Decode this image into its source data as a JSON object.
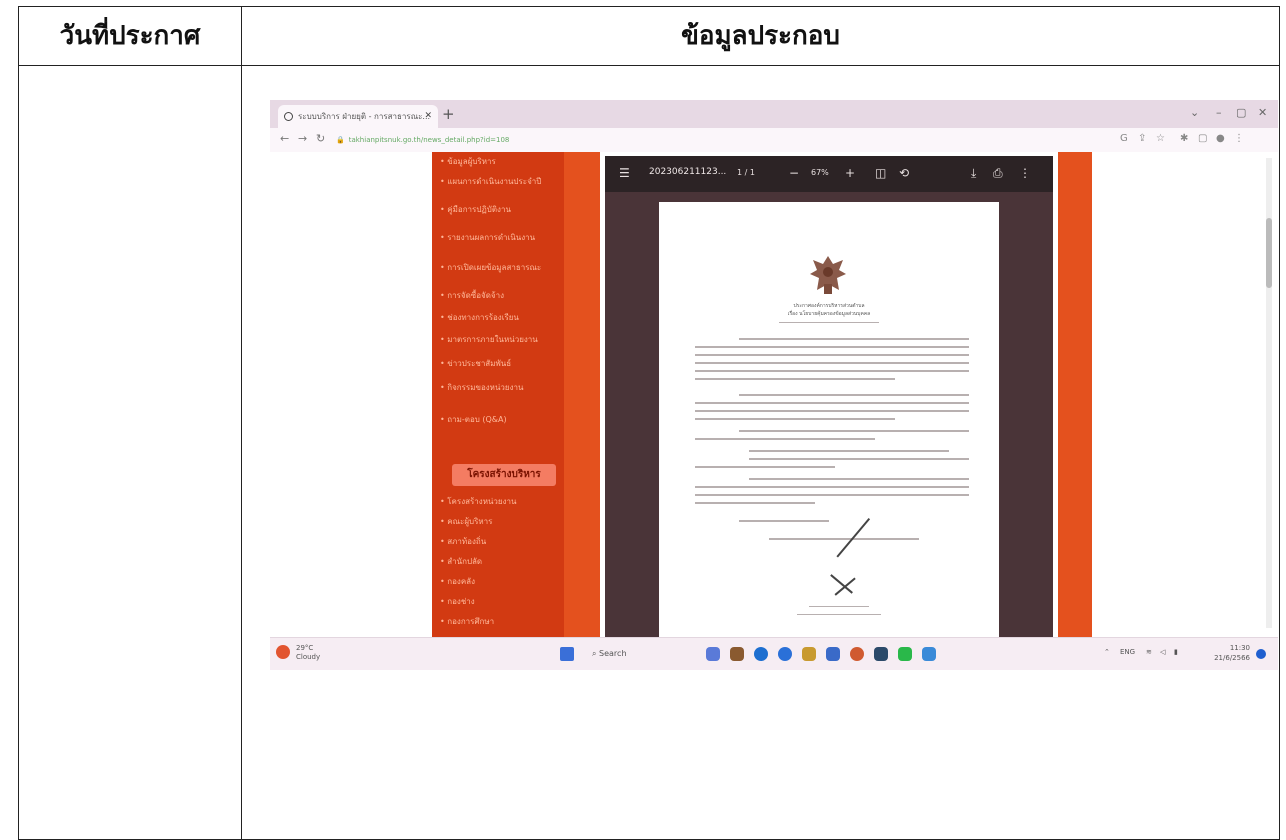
{
  "table": {
    "header_date": "วันที่ประกาศ",
    "header_info": "ข้อมูลประกอบ"
  },
  "browser": {
    "tab_title": "ระบบบริการ ฝ่ายยุติ - การสาธารณะ...",
    "url": "takhianpitsnuk.go.th/news_detail.php?id=108",
    "window_controls": [
      "⌄",
      "–",
      "▢",
      "✕"
    ]
  },
  "sidebar": {
    "links": [
      "• ข้อมูลผู้บริหาร",
      "• แผนการดำเนินงานประจำปี",
      "• คู่มือการปฏิบัติงาน",
      "• รายงานผลการดำเนินงาน",
      "• การเปิดเผยข้อมูลสาธารณะ",
      "• การจัดซื้อจัดจ้าง",
      "• ช่องทางการร้องเรียน",
      "• มาตรการภายในหน่วยงาน",
      "• ข่าวประชาสัมพันธ์",
      "• กิจกรรมของหน่วยงาน",
      "• ถาม-ตอบ (Q&A)"
    ],
    "structure_button": "โครงสร้างบริหาร",
    "structure_links": [
      "• โครงสร้างหน่วยงาน",
      "• คณะผู้บริหาร",
      "• สภาท้องถิ่น",
      "• สำนักปลัด",
      "• กองคลัง",
      "• กองช่าง",
      "• กองการศึกษา"
    ]
  },
  "pdf": {
    "filename": "202306211123...",
    "page_indicator": "1 / 1",
    "zoom": "67%",
    "sheet_heading_1": "ประกาศองค์การบริหารส่วนตำบล",
    "sheet_heading_2": "เรื่อง นโยบายคุ้มครองข้อมูลส่วนบุคคล"
  },
  "taskbar": {
    "weather_line1": "29°C",
    "weather_line2": "Cloudy",
    "search_placeholder": "Search",
    "lang": "ENG",
    "time": "11:30",
    "date": "21/6/2566"
  },
  "colors": {
    "sidebar_red": "#d23a12",
    "sidebar_orange": "#e4511e",
    "pdf_dark": "#2c2325",
    "structure_button": "#f47c62"
  }
}
